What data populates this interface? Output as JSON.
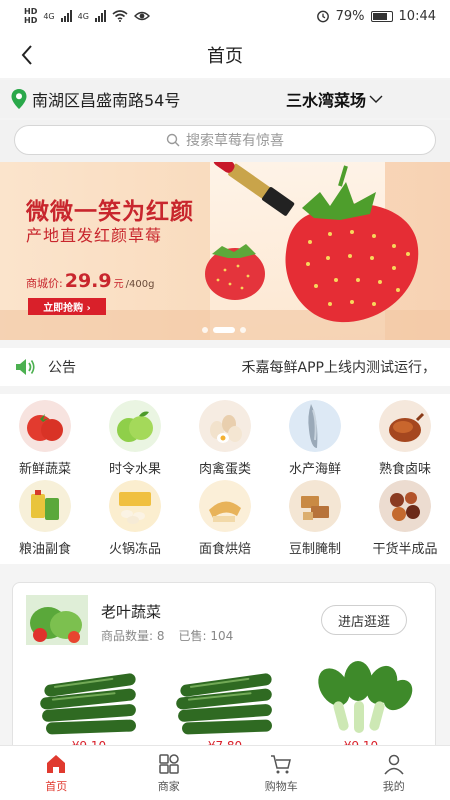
{
  "status_bar": {
    "net1": "HD",
    "net2": "HD",
    "signal1": "4G",
    "signal2": "4G",
    "battery": "79%",
    "time": "10:44"
  },
  "header": {
    "title": "首页"
  },
  "location": {
    "address": "南湖区昌盛南路54号",
    "market": "三水湾菜场"
  },
  "search": {
    "placeholder": "搜索草莓有惊喜"
  },
  "banner": {
    "title": "微微一笑为红颜",
    "subtitle": "产地直发红颜草莓",
    "price_label": "商城价:",
    "price": "29.9",
    "price_unit": "元",
    "price_weight": "/400g",
    "button": "立即抢购 ›",
    "active_slide": 2,
    "slide_count": 3
  },
  "notice": {
    "label": "公告",
    "text": "禾嘉每鲜APP上线内测试运行，"
  },
  "categories": [
    {
      "label": "新鲜蔬菜",
      "icon": "tomato-icon"
    },
    {
      "label": "时令水果",
      "icon": "apple-icon"
    },
    {
      "label": "肉禽蛋类",
      "icon": "eggs-icon"
    },
    {
      "label": "水产海鲜",
      "icon": "fish-icon"
    },
    {
      "label": "熟食卤味",
      "icon": "roast-duck-icon"
    },
    {
      "label": "粮油副食",
      "icon": "oil-icon"
    },
    {
      "label": "火锅冻品",
      "icon": "dumplings-icon"
    },
    {
      "label": "面食烘焙",
      "icon": "bread-icon"
    },
    {
      "label": "豆制腌制",
      "icon": "tofu-icon"
    },
    {
      "label": "干货半成品",
      "icon": "dried-goods-icon"
    }
  ],
  "store": {
    "name": "老叶蔬菜",
    "count_label": "商品数量: 8",
    "sold_label": "已售: 104",
    "visit_button": "进店逛逛",
    "products": [
      {
        "name": "cucumber",
        "price": "¥9.10"
      },
      {
        "name": "cucumber",
        "price": "¥7.80"
      },
      {
        "name": "bok-choy",
        "price": "¥9.10"
      }
    ]
  },
  "tabbar": [
    {
      "label": "首页",
      "icon": "home-icon",
      "active": true
    },
    {
      "label": "商家",
      "icon": "grid-icon",
      "active": false
    },
    {
      "label": "购物车",
      "icon": "cart-icon",
      "active": false
    },
    {
      "label": "我的",
      "icon": "user-icon",
      "active": false
    }
  ],
  "colors": {
    "accent": "#e03a2f",
    "brand_red": "#d9202a",
    "pin_green": "#2aa84a"
  }
}
